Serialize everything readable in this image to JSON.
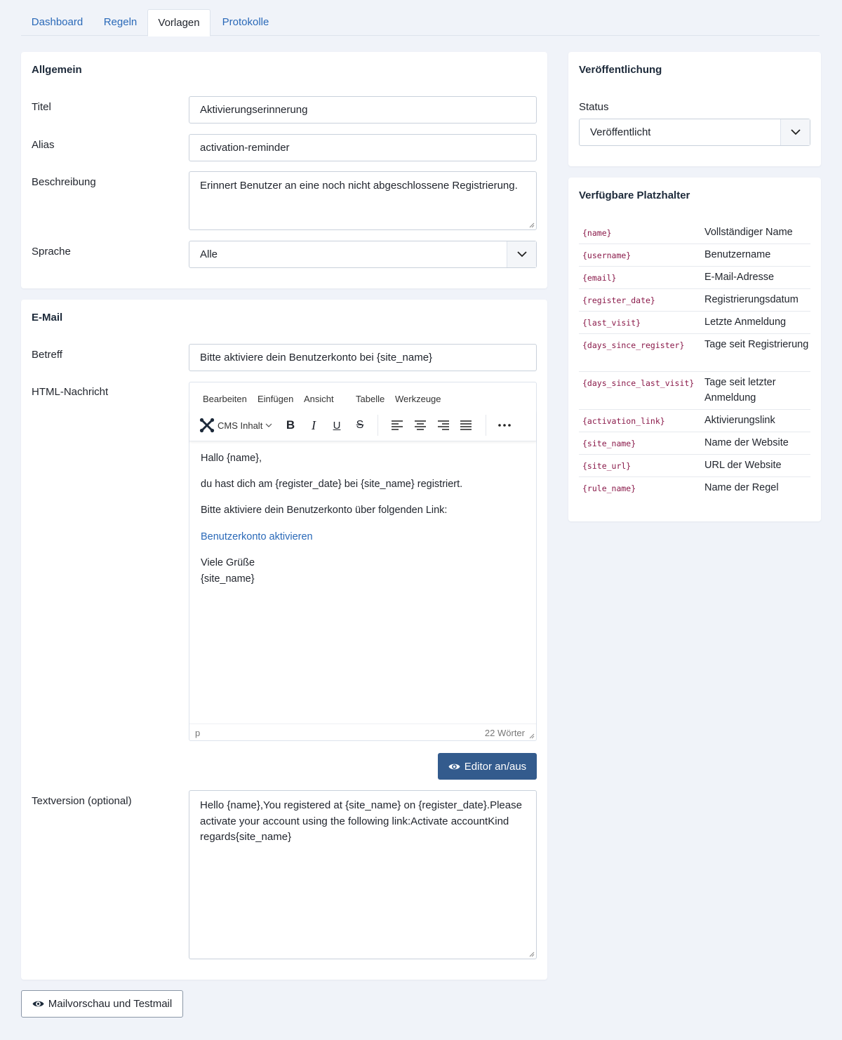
{
  "tabs": [
    {
      "label": "Dashboard"
    },
    {
      "label": "Regeln"
    },
    {
      "label": "Vorlagen"
    },
    {
      "label": "Protokolle"
    }
  ],
  "general": {
    "title": "Allgemein",
    "title_label": "Titel",
    "title_value": "Aktivierungserinnerung",
    "alias_label": "Alias",
    "alias_value": "activation-reminder",
    "description_label": "Beschreibung",
    "description_value": "Erinnert Benutzer an eine noch nicht abgeschlossene Registrierung.",
    "language_label": "Sprache",
    "language_value": "Alle"
  },
  "email": {
    "title": "E-Mail",
    "subject_label": "Betreff",
    "subject_value": "Bitte aktiviere dein Benutzerkonto bei {site_name}",
    "html_label": "HTML-Nachricht",
    "menu": [
      "Bearbeiten",
      "Einfügen",
      "Ansicht",
      "Tabelle",
      "Werkzeuge"
    ],
    "cms_content_label": "CMS Inhalt",
    "body": {
      "greeting": "Hallo {name},",
      "line1": "du hast dich am {register_date} bei {site_name} registriert.",
      "line2": "Bitte aktiviere dein Benutzerkonto über folgenden Link:",
      "link": "Benutzerkonto aktivieren",
      "closing": "Viele Grüße",
      "signature": "{site_name}"
    },
    "status_path": "p",
    "word_count": "22 Wörter",
    "toggle_editor_label": "Editor an/aus",
    "text_label": "Textversion (optional)",
    "text_value": "Hello {name},You registered at {site_name} on {register_date}.Please activate your account using the following link:Activate accountKind regards{site_name}"
  },
  "publishing": {
    "title": "Veröffentlichung",
    "status_label": "Status",
    "status_value": "Veröffentlicht"
  },
  "placeholders": {
    "title": "Verfügbare Platzhalter",
    "rows": [
      {
        "code": "{name}",
        "desc": "Vollständiger Name"
      },
      {
        "code": "{username}",
        "desc": "Benutzername"
      },
      {
        "code": "{email}",
        "desc": "E-Mail-Adresse"
      },
      {
        "code": "{register_date}",
        "desc": "Registrierungsdatum"
      },
      {
        "code": "{last_visit}",
        "desc": "Letzte Anmeldung"
      },
      {
        "code": "{days_since_register}",
        "desc": "Tage seit Registrierung"
      },
      {
        "code": "{days_since_last_visit}",
        "desc": "Tage seit letzter Anmeldung"
      },
      {
        "code": "{activation_link}",
        "desc": "Aktivierungslink"
      },
      {
        "code": "{site_name}",
        "desc": "Name der Website"
      },
      {
        "code": "{site_url}",
        "desc": "URL der Website"
      },
      {
        "code": "{rule_name}",
        "desc": "Name der Regel"
      }
    ]
  },
  "preview_button_label": "Mailvorschau und Testmail",
  "colors": {
    "accent": "#335b8d",
    "link": "#2a69b8",
    "code": "#8a1a4a",
    "background": "#f0f3f9"
  }
}
